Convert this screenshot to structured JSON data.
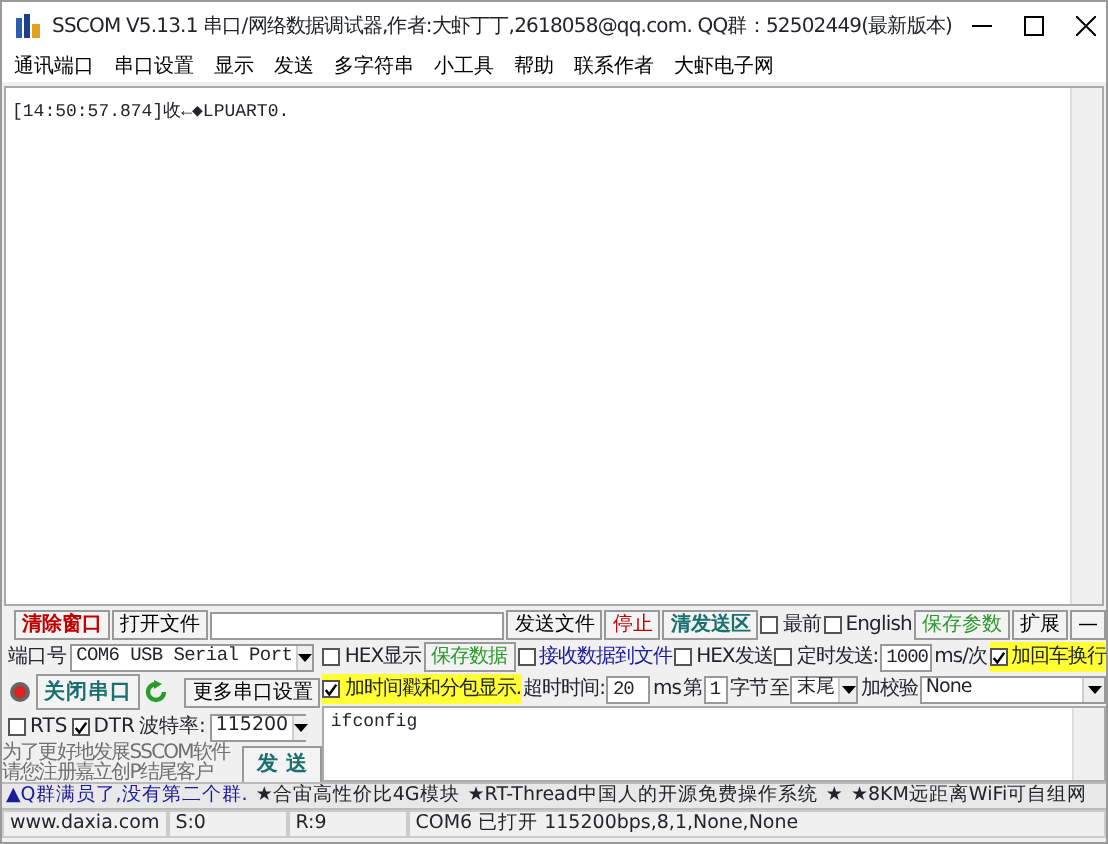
{
  "window": {
    "title": "SSCOM V5.13.1 串口/网络数据调试器,作者:大虾丁丁,2618058@qq.com. QQ群：52502449(最新版本)"
  },
  "menu": [
    "通讯端口",
    "串口设置",
    "显示",
    "发送",
    "多字符串",
    "小工具",
    "帮助",
    "联系作者",
    "大虾电子网"
  ],
  "receive_log": [
    "[14:50:57.874]收←◆LPUART0."
  ],
  "file_row": {
    "clear_button": "清除窗口",
    "open_file_button": "打开文件",
    "send_file_button": "发送文件",
    "stop_button": "停止",
    "clear_send_button": "清发送区",
    "options": [
      {
        "label": "最前",
        "checked": false
      },
      {
        "label": "English",
        "checked": false
      }
    ],
    "save_params_button": "保存参数",
    "expand_button": "扩展",
    "collapse_button": "—"
  },
  "port": {
    "label": "端口号",
    "value": "COM6 USB Serial Port",
    "open": true,
    "toggle_button": "关闭串口",
    "more_button": "更多串口设置",
    "lines": [
      {
        "label": "RTS",
        "checked": false
      },
      {
        "label": "DTR",
        "checked": true
      }
    ],
    "baud_label": "波特率:",
    "baud": "115200"
  },
  "promo": [
    "为了更好地发展SSCOM软件",
    "请您注册嘉立创P结尾客户"
  ],
  "send_button": "发 送",
  "options_row1": {
    "hex_display": {
      "label": "HEX显示",
      "checked": false
    },
    "save_data_button": "保存数据",
    "receive_to_file": {
      "label": "接收数据到文件",
      "checked": false
    },
    "hex_send": {
      "label": "HEX发送",
      "checked": false
    },
    "timed_send": {
      "label": "定时发送:",
      "checked": false
    },
    "interval": "1000",
    "interval_unit": "ms/次",
    "add_crlf": {
      "label": "加回车换行",
      "checked": true
    }
  },
  "options_row2": {
    "timestamp": {
      "label": "加时间戳和分包显示.",
      "checked": true
    },
    "timeout_label": "超时时间:",
    "timeout": "20",
    "timeout_unit": "ms",
    "byte_prefix": "第",
    "byte_from": "1",
    "byte_label": "字节",
    "to_label": "至",
    "byte_to": "末尾",
    "checksum_label": "加校验",
    "checksum": "None"
  },
  "send_text": "ifconfig",
  "ticker": [
    "▲Q群满员了,没有第二个群.",
    "★合宙高性价比4G模块",
    "★RT-Thread中国人的开源免费操作系统",
    "★",
    "★8KM远距离WiFi可自组网"
  ],
  "status_bar": [
    "www.daxia.com",
    "S:0",
    "R:9",
    "COM6 已打开  115200bps,8,1,None,None"
  ]
}
